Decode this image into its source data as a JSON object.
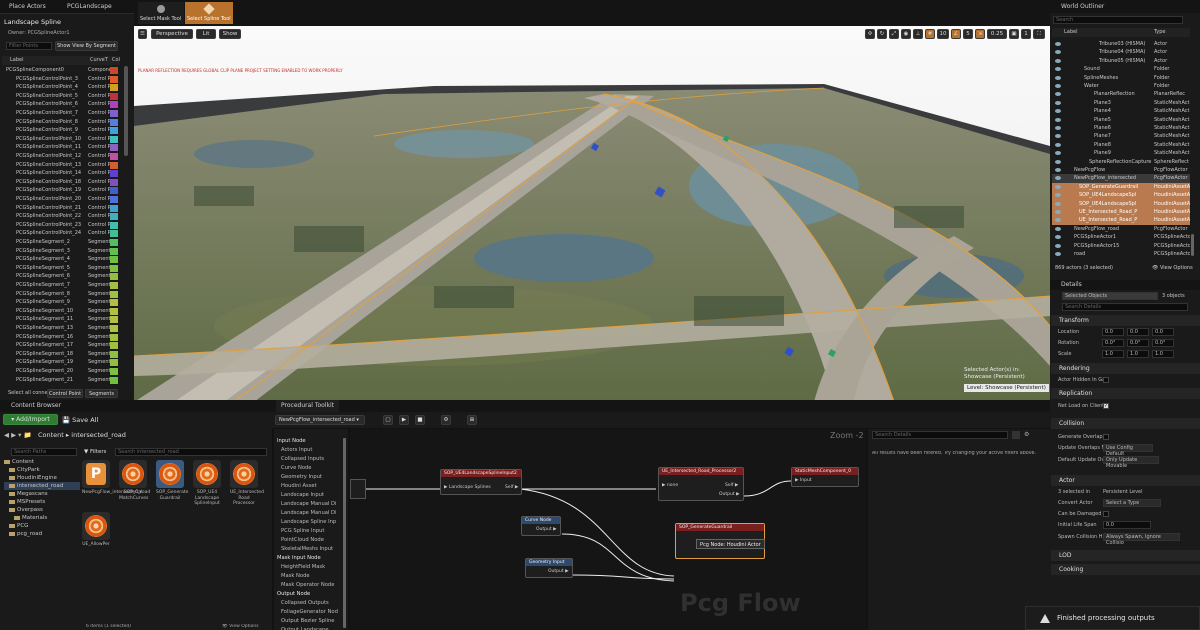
{
  "top_tabs": {
    "place_actors": "Place Actors",
    "pcg_landscape": "PCGLandscape",
    "select_mask_tool": "Select Mask Tool",
    "select_spline_tool": "Select Spline Tool",
    "world_outliner": "World Outliner"
  },
  "spline_panel": {
    "title": "Landscape Spline",
    "owner": "Owner: PCGSplineActor1",
    "filter_placeholder": "Filter Points",
    "show_by_segment": "Show View By Segment",
    "col_label": "Label",
    "col_curve": "CurveT",
    "col_col": "Col",
    "rows": [
      {
        "label": "PCGSplineComponent0",
        "type": "Compone",
        "color": "#c84a2a"
      },
      {
        "label": "PCGSplineControlPoint_3",
        "type": "Control P",
        "color": "#e05a2a"
      },
      {
        "label": "PCGSplineControlPoint_4",
        "type": "Control P",
        "color": "#d0a020"
      },
      {
        "label": "PCGSplineControlPoint_5",
        "type": "Control P",
        "color": "#c03040"
      },
      {
        "label": "PCGSplineControlPoint_6",
        "type": "Control P",
        "color": "#b040c0"
      },
      {
        "label": "PCGSplineControlPoint_7",
        "type": "Control P",
        "color": "#8060d0"
      },
      {
        "label": "PCGSplineControlPoint_8",
        "type": "Control P",
        "color": "#5080e0"
      },
      {
        "label": "PCGSplineControlPoint_9",
        "type": "Control P",
        "color": "#40a0e0"
      },
      {
        "label": "PCGSplineControlPoint_10",
        "type": "Control P",
        "color": "#40c0c0"
      },
      {
        "label": "PCGSplineControlPoint_11",
        "type": "Control P",
        "color": "#9060c0"
      },
      {
        "label": "PCGSplineControlPoint_12",
        "type": "Control P",
        "color": "#c050a0"
      },
      {
        "label": "PCGSplineControlPoint_13",
        "type": "Control P",
        "color": "#d06030"
      },
      {
        "label": "PCGSplineControlPoint_14",
        "type": "Control P",
        "color": "#6040d0"
      },
      {
        "label": "PCGSplineControlPoint_18",
        "type": "Control P",
        "color": "#8050c0"
      },
      {
        "label": "PCGSplineControlPoint_19",
        "type": "Control P",
        "color": "#4060d0"
      },
      {
        "label": "PCGSplineControlPoint_20",
        "type": "Control P",
        "color": "#5070e0"
      },
      {
        "label": "PCGSplineControlPoint_21",
        "type": "Control P",
        "color": "#40a0d0"
      },
      {
        "label": "PCGSplineControlPoint_22",
        "type": "Control P",
        "color": "#40b0c0"
      },
      {
        "label": "PCGSplineControlPoint_23",
        "type": "Control P",
        "color": "#40c0b0"
      },
      {
        "label": "PCGSplineControlPoint_24",
        "type": "Control P",
        "color": "#40c090"
      },
      {
        "label": "PCGSplineSegment_2",
        "type": "Segment",
        "color": "#50c060"
      },
      {
        "label": "PCGSplineSegment_3",
        "type": "Segment",
        "color": "#60c050"
      },
      {
        "label": "PCGSplineSegment_4",
        "type": "Segment",
        "color": "#70c040"
      },
      {
        "label": "PCGSplineSegment_5",
        "type": "Segment",
        "color": "#80c040"
      },
      {
        "label": "PCGSplineSegment_6",
        "type": "Segment",
        "color": "#90c040"
      },
      {
        "label": "PCGSplineSegment_7",
        "type": "Segment",
        "color": "#a0c040"
      },
      {
        "label": "PCGSplineSegment_8",
        "type": "Segment",
        "color": "#a0c040"
      },
      {
        "label": "PCGSplineSegment_9",
        "type": "Segment",
        "color": "#b0c040"
      },
      {
        "label": "PCGSplineSegment_10",
        "type": "Segment",
        "color": "#b0c040"
      },
      {
        "label": "PCGSplineSegment_11",
        "type": "Segment",
        "color": "#b0c040"
      },
      {
        "label": "PCGSplineSegment_13",
        "type": "Segment",
        "color": "#b0c040"
      },
      {
        "label": "PCGSplineSegment_16",
        "type": "Segment",
        "color": "#a0c040"
      },
      {
        "label": "PCGSplineSegment_17",
        "type": "Segment",
        "color": "#a0c040"
      },
      {
        "label": "PCGSplineSegment_18",
        "type": "Segment",
        "color": "#90c040"
      },
      {
        "label": "PCGSplineSegment_19",
        "type": "Segment",
        "color": "#90c040"
      },
      {
        "label": "PCGSplineSegment_20",
        "type": "Segment",
        "color": "#80c040"
      },
      {
        "label": "PCGSplineSegment_21",
        "type": "Segment",
        "color": "#70c040"
      }
    ],
    "select_all": "Select all conne",
    "btn_control_point": "Control Point",
    "btn_segments": "Segments"
  },
  "viewport": {
    "btn_perspective": "Perspective",
    "btn_lit": "Lit",
    "btn_show": "Show",
    "warning": "PLANAR REFLECTION REQUIRES GLOBAL CLIP PLANE PROJECT SETTING ENABLED TO WORK PROPERLY",
    "snap_values": [
      "10",
      "5",
      "0.25",
      "1"
    ],
    "selected_line1": "Selected Actor(s) in:",
    "selected_line2": "Showcase (Persistent)",
    "level": "Level: Showcase (Persistent)"
  },
  "outliner": {
    "search_placeholder": "Search",
    "col_label": "Label",
    "col_type": "Type",
    "rows": [
      {
        "label": "Tribune03 (HISMA)",
        "type": "Actor",
        "indent": 7,
        "hl": false
      },
      {
        "label": "Tribune04 (HISMA)",
        "type": "Actor",
        "indent": 7,
        "hl": false
      },
      {
        "label": "Tribune05 (HISMA)",
        "type": "Actor",
        "indent": 7,
        "hl": false
      },
      {
        "label": "Sound",
        "type": "Folder",
        "indent": 4,
        "hl": false
      },
      {
        "label": "SplineMeshes",
        "type": "Folder",
        "indent": 4,
        "hl": false
      },
      {
        "label": "Water",
        "type": "Folder",
        "indent": 4,
        "hl": false
      },
      {
        "label": "PlanarReflection",
        "type": "PlanarReflec",
        "indent": 6,
        "hl": false
      },
      {
        "label": "Plane3",
        "type": "StaticMeshAct",
        "indent": 6,
        "hl": false
      },
      {
        "label": "Plane4",
        "type": "StaticMeshAct",
        "indent": 6,
        "hl": false
      },
      {
        "label": "Plane5",
        "type": "StaticMeshAct",
        "indent": 6,
        "hl": false
      },
      {
        "label": "Plane6",
        "type": "StaticMeshAct",
        "indent": 6,
        "hl": false
      },
      {
        "label": "Plane7",
        "type": "StaticMeshAct",
        "indent": 6,
        "hl": false
      },
      {
        "label": "Plane8",
        "type": "StaticMeshAct",
        "indent": 6,
        "hl": false
      },
      {
        "label": "Plane9",
        "type": "StaticMeshAct",
        "indent": 6,
        "hl": false
      },
      {
        "label": "SphereReflectionCapture",
        "type": "SphereReflect",
        "indent": 5,
        "hl": false
      },
      {
        "label": "NewPcgFlow",
        "type": "PcgFlowActor",
        "indent": 2,
        "hl": false
      },
      {
        "label": "NewPcgFlow_intersected",
        "type": "PcgFlowActor",
        "indent": 2,
        "hl": "sel"
      },
      {
        "label": "SOP_GenerateGuardrail",
        "type": "HoudiniAssetA",
        "indent": 3,
        "hl": "orange"
      },
      {
        "label": "SOP_UE4LandscapeSpl",
        "type": "HoudiniAssetA",
        "indent": 3,
        "hl": "orange"
      },
      {
        "label": "SOP_UE4LandscapeSpl",
        "type": "HoudiniAssetA",
        "indent": 3,
        "hl": "orange"
      },
      {
        "label": "UE_Intersected_Road_P",
        "type": "HoudiniAssetA",
        "indent": 3,
        "hl": "orange"
      },
      {
        "label": "UE_Intersected_Road_P",
        "type": "HoudiniAssetA",
        "indent": 3,
        "hl": "orange"
      },
      {
        "label": "NewPcgFlow_road",
        "type": "PcgFlowActor",
        "indent": 2,
        "hl": false
      },
      {
        "label": "PCGSplineActor1",
        "type": "PCGSplineActo",
        "indent": 2,
        "hl": false
      },
      {
        "label": "PCGSplineActor15",
        "type": "PCGSplineActo",
        "indent": 2,
        "hl": false
      },
      {
        "label": "road",
        "type": "PCGSplineActo",
        "indent": 2,
        "hl": false
      }
    ],
    "count": "869 actors (3 selected)",
    "view_options": "View Options"
  },
  "details": {
    "tab": "Details",
    "selected_objects": "3 objects",
    "selected_field": "Selected Objects",
    "search_placeholder": "Search Details",
    "transform": "Transform",
    "location": "Location",
    "rotation": "Rotation",
    "scale": "Scale",
    "loc_values": [
      "0.0",
      "0.0",
      "0.0"
    ],
    "rot_values": [
      "0.0°",
      "0.0°",
      "0.0°"
    ],
    "scale_values": [
      "1.0",
      "1.0",
      "1.0"
    ],
    "rendering": "Rendering",
    "actor_hidden": "Actor Hidden In Ga",
    "replication": "Replication",
    "net_load": "Net Load on Client",
    "collision": "Collision",
    "gen_overlap": "Generate Overlap E",
    "update_overlaps": "Update Overlaps M",
    "update_overlaps_val": "Use Config Default",
    "default_update": "Default Update Ov",
    "default_update_val": "Only Update Movable",
    "actor": "Actor",
    "selected_in": "3 selected in",
    "selected_in_val": "Persistent Level",
    "convert_actor": "Convert Actor",
    "convert_actor_val": "Select a Type",
    "can_be_damaged": "Can be Damaged",
    "initial_life": "Initial Life Span",
    "initial_life_val": "0.0",
    "spawn_collision": "Spawn Collision H",
    "spawn_collision_val": "Always Spawn, Ignore Collisio",
    "lod": "LOD",
    "cooking": "Cooking"
  },
  "content_browser": {
    "tab": "Content Browser",
    "add_import": "Add/Import",
    "save_all": "Save All",
    "path_content": "Content",
    "path_folder": "intersected_road",
    "search_paths": "Search Paths",
    "filters": "Filters",
    "search_assets": "Search intersected_road",
    "tree": [
      {
        "label": "Content",
        "indent": 0
      },
      {
        "label": "CityPark",
        "indent": 1
      },
      {
        "label": "HoudiniEngine",
        "indent": 1
      },
      {
        "label": "intersected_road",
        "indent": 1
      },
      {
        "label": "Megascans",
        "indent": 1
      },
      {
        "label": "MSPresets",
        "indent": 1
      },
      {
        "label": "Overpass",
        "indent": 1
      },
      {
        "label": "Materials",
        "indent": 2
      },
      {
        "label": "PCG",
        "indent": 1
      },
      {
        "label": "pcg_road",
        "indent": 1
      }
    ],
    "assets": [
      {
        "name": "NewPcgFlow_intersected_road",
        "kind": "pcg"
      },
      {
        "name": "SOP_Cal MatchCurves",
        "kind": "houdini"
      },
      {
        "name": "SOP_Generate Guardrail",
        "kind": "houdini"
      },
      {
        "name": "SOP_UE4 Landscape SplineInput",
        "kind": "houdini"
      },
      {
        "name": "UE_Intersected Road Processor",
        "kind": "houdini"
      },
      {
        "name": "UE_AllowPer",
        "kind": "houdini"
      }
    ],
    "status": "6 items (1 selected)",
    "view_options": "View Options"
  },
  "toolkit": {
    "tab": "Procedural Toolkit",
    "graph_selector": "NewPcgFlow_intersected_road",
    "zoom": "Zoom -2",
    "search_details": "Search Details",
    "filtered_msg": "All results have been filtered. Try changing your active filters above.",
    "watermark": "Pcg Flow",
    "palette": [
      {
        "label": "Input Node",
        "header": true
      },
      {
        "label": "Actors Input",
        "header": false
      },
      {
        "label": "Collapsed Inputs",
        "header": false
      },
      {
        "label": "Curve Node",
        "header": false
      },
      {
        "label": "Geometry Input",
        "header": false
      },
      {
        "label": "Houdini Asset",
        "header": false
      },
      {
        "label": "Landscape Input",
        "header": false
      },
      {
        "label": "Landscape Manual Di",
        "header": false
      },
      {
        "label": "Landscape Manual Di",
        "header": false
      },
      {
        "label": "Landscape Spline Inp",
        "header": false
      },
      {
        "label": "PCG Spline Input",
        "header": false
      },
      {
        "label": "PointCloud Node",
        "header": false
      },
      {
        "label": "SkeletalMeshs Input",
        "header": false
      },
      {
        "label": "Mask Input Node",
        "header": true
      },
      {
        "label": "HeightField Mask",
        "header": false
      },
      {
        "label": "Mask Node",
        "header": false
      },
      {
        "label": "Mask Operator Node",
        "header": false
      },
      {
        "label": "Output Node",
        "header": true
      },
      {
        "label": "Collapsed Outputs",
        "header": false
      },
      {
        "label": "FoliageGenerator Nod",
        "header": false
      },
      {
        "label": "Output Bezier Spline",
        "header": false
      },
      {
        "label": "Output Landscape",
        "header": false
      }
    ],
    "nodes": {
      "spline_input": {
        "title": "SOP_UE4LandscapeSplineInput2",
        "pin_in": "Landscape Splines",
        "pin_out": "Self"
      },
      "road_processor": {
        "title": "UE_Intersected_Road_Processor2",
        "pin_in": "none",
        "pin_out1": "Self",
        "pin_out2": "Output"
      },
      "static_mesh": {
        "title": "StaticMeshComponent_0",
        "pin_in": "Input"
      },
      "curve_node": {
        "title": "Curve Node",
        "pin_out": "Output"
      },
      "guardrail": {
        "title": "SOP_GenerateGuardrail",
        "tooltip": "Pcg Node: Houdini Actor"
      },
      "geometry_input": {
        "title": "Geometry Input",
        "pin_out": "Output"
      }
    }
  },
  "toast": {
    "text": "Finished processing outputs"
  }
}
